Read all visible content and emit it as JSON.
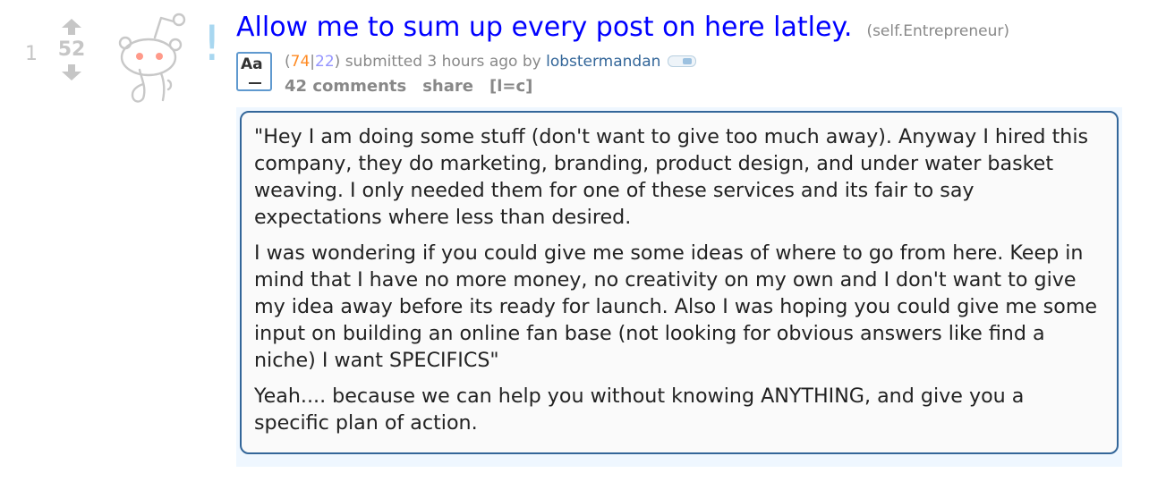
{
  "post": {
    "rank": "1",
    "score": "52",
    "title": "Allow me to sum up every post on here latley.",
    "domain": "(self.Entrepreneur)",
    "tagline": {
      "open_paren": "(",
      "upvotes": "74",
      "separator": "|",
      "downvotes": "22",
      "close_paren": ")",
      "submitted": "submitted 3 hours ago by",
      "author": "lobstermandan"
    },
    "buttons": {
      "comments": "42 comments",
      "share": "share",
      "extra": "[l=c]"
    },
    "icons": {
      "self_post_indicator": "!",
      "text_style_badge": "Aa",
      "thumbnail": "reddit-alien-thinking-icon",
      "up": "upvote-arrow-icon",
      "down": "downvote-arrow-icon",
      "flair": "flair-pill-icon"
    },
    "selftext": [
      "\"Hey I am doing some stuff (don't want to give too much away). Anyway I hired this company, they do marketing, branding, product design, and under water basket weaving. I only needed them for one of these services and its fair to say expectations where less than desired.",
      "I was wondering if you could give me some ideas of where to go from here. Keep in mind that I have no more money, no creativity on my own and I don't want to give my idea away before its ready for launch. Also I was hoping you could give me some input on building an online fan base (not looking for obvious answers like find a niche) I want SPECIFICS\"",
      "Yeah.... because we can help you without knowing ANYTHING, and give you a specific plan of action."
    ]
  },
  "colors": {
    "title": "#0000ff",
    "upvote_count": "#ff8b24",
    "downvote_count": "#9494ff",
    "author": "#336699",
    "vote_gray": "#c6c6c6",
    "expando_bg": "#eff7ff",
    "selftext_border": "#336699"
  }
}
